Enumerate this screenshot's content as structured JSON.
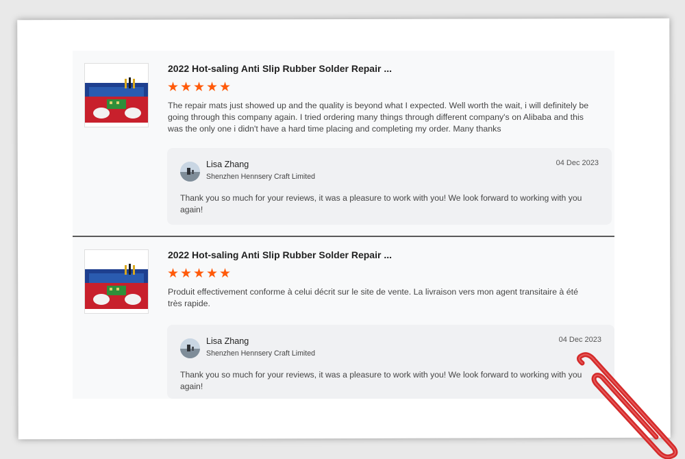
{
  "colors": {
    "star": "#ff5a0a",
    "clip": "#d42a2a"
  },
  "reviews": [
    {
      "product_title": "2022 Hot-saling Anti Slip Rubber Solder Repair ...",
      "rating": 5,
      "text": "The repair mats just showed up and the quality is beyond what I expected. Well worth the wait, i will definitely be going through this company again. I tried ordering many things through different company's on Alibaba and this was the only one i didn't have a hard time placing and completing my order. Many thanks",
      "reply": {
        "name": "Lisa Zhang",
        "company": "Shenzhen Hennsery Craft Limited",
        "date": "04 Dec 2023",
        "text": "Thank you so much for your reviews, it was a pleasure to work with you! We look forward to working with you again!"
      }
    },
    {
      "product_title": "2022 Hot-saling Anti Slip Rubber Solder Repair ...",
      "rating": 5,
      "text": "Produit effectivement conforme à celui décrit sur le site de vente. La livraison vers mon agent transitaire à été très rapide.",
      "reply": {
        "name": "Lisa Zhang",
        "company": "Shenzhen Hennsery Craft Limited",
        "date": "04 Dec 2023",
        "text": "Thank you so much for your reviews, it was a pleasure to work with you! We look forward to working with you again!"
      }
    }
  ],
  "icons": {
    "star": "star-icon",
    "clip": "paperclip-icon"
  }
}
